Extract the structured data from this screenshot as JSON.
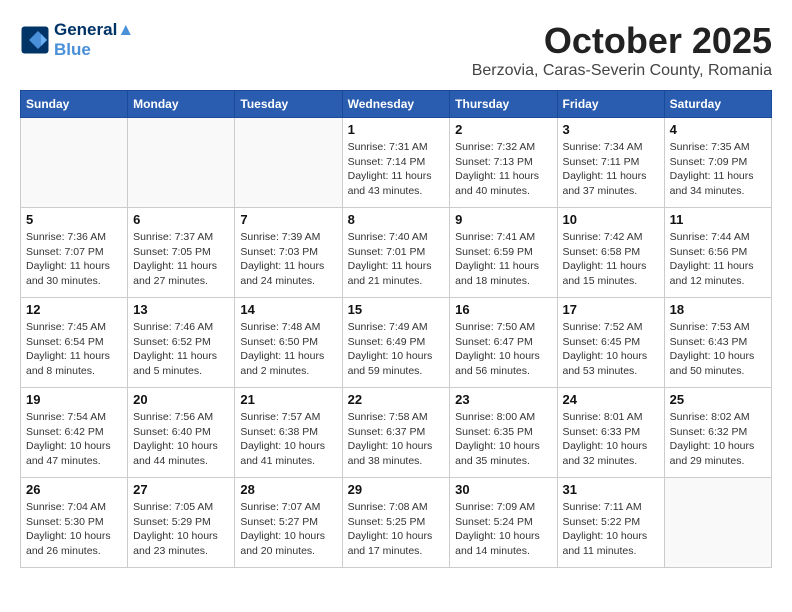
{
  "logo": {
    "line1": "General",
    "line2": "Blue"
  },
  "title": "October 2025",
  "subtitle": "Berzovia, Caras-Severin County, Romania",
  "days_of_week": [
    "Sunday",
    "Monday",
    "Tuesday",
    "Wednesday",
    "Thursday",
    "Friday",
    "Saturday"
  ],
  "weeks": [
    [
      {
        "day": "",
        "info": ""
      },
      {
        "day": "",
        "info": ""
      },
      {
        "day": "",
        "info": ""
      },
      {
        "day": "1",
        "info": "Sunrise: 7:31 AM\nSunset: 7:14 PM\nDaylight: 11 hours and 43 minutes."
      },
      {
        "day": "2",
        "info": "Sunrise: 7:32 AM\nSunset: 7:13 PM\nDaylight: 11 hours and 40 minutes."
      },
      {
        "day": "3",
        "info": "Sunrise: 7:34 AM\nSunset: 7:11 PM\nDaylight: 11 hours and 37 minutes."
      },
      {
        "day": "4",
        "info": "Sunrise: 7:35 AM\nSunset: 7:09 PM\nDaylight: 11 hours and 34 minutes."
      }
    ],
    [
      {
        "day": "5",
        "info": "Sunrise: 7:36 AM\nSunset: 7:07 PM\nDaylight: 11 hours and 30 minutes."
      },
      {
        "day": "6",
        "info": "Sunrise: 7:37 AM\nSunset: 7:05 PM\nDaylight: 11 hours and 27 minutes."
      },
      {
        "day": "7",
        "info": "Sunrise: 7:39 AM\nSunset: 7:03 PM\nDaylight: 11 hours and 24 minutes."
      },
      {
        "day": "8",
        "info": "Sunrise: 7:40 AM\nSunset: 7:01 PM\nDaylight: 11 hours and 21 minutes."
      },
      {
        "day": "9",
        "info": "Sunrise: 7:41 AM\nSunset: 6:59 PM\nDaylight: 11 hours and 18 minutes."
      },
      {
        "day": "10",
        "info": "Sunrise: 7:42 AM\nSunset: 6:58 PM\nDaylight: 11 hours and 15 minutes."
      },
      {
        "day": "11",
        "info": "Sunrise: 7:44 AM\nSunset: 6:56 PM\nDaylight: 11 hours and 12 minutes."
      }
    ],
    [
      {
        "day": "12",
        "info": "Sunrise: 7:45 AM\nSunset: 6:54 PM\nDaylight: 11 hours and 8 minutes."
      },
      {
        "day": "13",
        "info": "Sunrise: 7:46 AM\nSunset: 6:52 PM\nDaylight: 11 hours and 5 minutes."
      },
      {
        "day": "14",
        "info": "Sunrise: 7:48 AM\nSunset: 6:50 PM\nDaylight: 11 hours and 2 minutes."
      },
      {
        "day": "15",
        "info": "Sunrise: 7:49 AM\nSunset: 6:49 PM\nDaylight: 10 hours and 59 minutes."
      },
      {
        "day": "16",
        "info": "Sunrise: 7:50 AM\nSunset: 6:47 PM\nDaylight: 10 hours and 56 minutes."
      },
      {
        "day": "17",
        "info": "Sunrise: 7:52 AM\nSunset: 6:45 PM\nDaylight: 10 hours and 53 minutes."
      },
      {
        "day": "18",
        "info": "Sunrise: 7:53 AM\nSunset: 6:43 PM\nDaylight: 10 hours and 50 minutes."
      }
    ],
    [
      {
        "day": "19",
        "info": "Sunrise: 7:54 AM\nSunset: 6:42 PM\nDaylight: 10 hours and 47 minutes."
      },
      {
        "day": "20",
        "info": "Sunrise: 7:56 AM\nSunset: 6:40 PM\nDaylight: 10 hours and 44 minutes."
      },
      {
        "day": "21",
        "info": "Sunrise: 7:57 AM\nSunset: 6:38 PM\nDaylight: 10 hours and 41 minutes."
      },
      {
        "day": "22",
        "info": "Sunrise: 7:58 AM\nSunset: 6:37 PM\nDaylight: 10 hours and 38 minutes."
      },
      {
        "day": "23",
        "info": "Sunrise: 8:00 AM\nSunset: 6:35 PM\nDaylight: 10 hours and 35 minutes."
      },
      {
        "day": "24",
        "info": "Sunrise: 8:01 AM\nSunset: 6:33 PM\nDaylight: 10 hours and 32 minutes."
      },
      {
        "day": "25",
        "info": "Sunrise: 8:02 AM\nSunset: 6:32 PM\nDaylight: 10 hours and 29 minutes."
      }
    ],
    [
      {
        "day": "26",
        "info": "Sunrise: 7:04 AM\nSunset: 5:30 PM\nDaylight: 10 hours and 26 minutes."
      },
      {
        "day": "27",
        "info": "Sunrise: 7:05 AM\nSunset: 5:29 PM\nDaylight: 10 hours and 23 minutes."
      },
      {
        "day": "28",
        "info": "Sunrise: 7:07 AM\nSunset: 5:27 PM\nDaylight: 10 hours and 20 minutes."
      },
      {
        "day": "29",
        "info": "Sunrise: 7:08 AM\nSunset: 5:25 PM\nDaylight: 10 hours and 17 minutes."
      },
      {
        "day": "30",
        "info": "Sunrise: 7:09 AM\nSunset: 5:24 PM\nDaylight: 10 hours and 14 minutes."
      },
      {
        "day": "31",
        "info": "Sunrise: 7:11 AM\nSunset: 5:22 PM\nDaylight: 10 hours and 11 minutes."
      },
      {
        "day": "",
        "info": ""
      }
    ]
  ]
}
